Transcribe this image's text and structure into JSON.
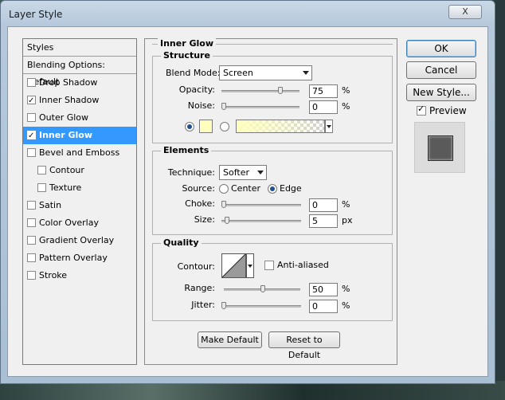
{
  "window": {
    "title": "Layer Style",
    "close_label": "X"
  },
  "styles_list": {
    "items": [
      {
        "label": "Styles",
        "checkbox": false,
        "checked": false,
        "header": true
      },
      {
        "label": "Blending Options: Default",
        "checkbox": false,
        "checked": false,
        "header": true
      },
      {
        "label": "Drop Shadow",
        "checkbox": true,
        "checked": false
      },
      {
        "label": "Inner Shadow",
        "checkbox": true,
        "checked": true
      },
      {
        "label": "Outer Glow",
        "checkbox": true,
        "checked": false
      },
      {
        "label": "Inner Glow",
        "checkbox": true,
        "checked": true,
        "selected": true
      },
      {
        "label": "Bevel and Emboss",
        "checkbox": true,
        "checked": false
      },
      {
        "label": "Contour",
        "checkbox": true,
        "checked": false,
        "indent": true
      },
      {
        "label": "Texture",
        "checkbox": true,
        "checked": false,
        "indent": true
      },
      {
        "label": "Satin",
        "checkbox": true,
        "checked": false
      },
      {
        "label": "Color Overlay",
        "checkbox": true,
        "checked": false
      },
      {
        "label": "Gradient Overlay",
        "checkbox": true,
        "checked": false
      },
      {
        "label": "Pattern Overlay",
        "checkbox": true,
        "checked": false
      },
      {
        "label": "Stroke",
        "checkbox": true,
        "checked": false
      }
    ]
  },
  "panel": {
    "title": "Inner Glow",
    "structure": {
      "title": "Structure",
      "blend_mode_label": "Blend Mode:",
      "blend_mode_value": "Screen",
      "opacity_label": "Opacity:",
      "opacity_value": "75",
      "opacity_unit": "%",
      "noise_label": "Noise:",
      "noise_value": "0",
      "noise_unit": "%",
      "color_swatch": "#ffffbe"
    },
    "elements": {
      "title": "Elements",
      "technique_label": "Technique:",
      "technique_value": "Softer",
      "source_label": "Source:",
      "source_center": "Center",
      "source_edge": "Edge",
      "choke_label": "Choke:",
      "choke_value": "0",
      "choke_unit": "%",
      "size_label": "Size:",
      "size_value": "5",
      "size_unit": "px"
    },
    "quality": {
      "title": "Quality",
      "contour_label": "Contour:",
      "anti_aliased_label": "Anti-aliased",
      "range_label": "Range:",
      "range_value": "50",
      "range_unit": "%",
      "jitter_label": "Jitter:",
      "jitter_value": "0",
      "jitter_unit": "%"
    },
    "make_default": "Make Default",
    "reset_default": "Reset to Default"
  },
  "actions": {
    "ok": "OK",
    "cancel": "Cancel",
    "new_style": "New Style...",
    "preview_label": "Preview"
  },
  "colors": {
    "accent": "#3399ff",
    "glow": "#ffffbe"
  }
}
